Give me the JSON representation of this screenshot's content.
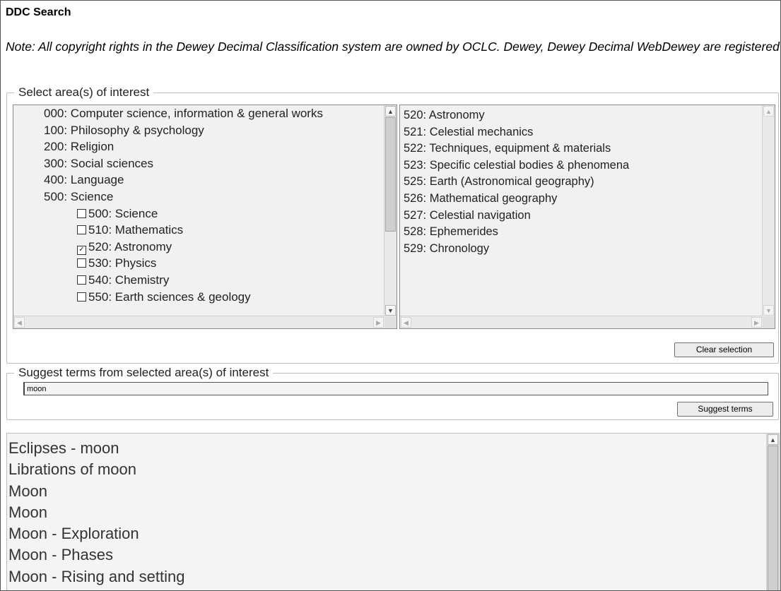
{
  "header": {
    "title": "DDC Search",
    "note": "Note: All copyright rights in the Dewey Decimal Classification system are owned by OCLC. Dewey, Dewey Decimal WebDewey are registered trademarks of OCLC."
  },
  "areas": {
    "legend": "Select area(s) of interest",
    "tree": [
      {
        "label": "000: Computer science, information & general works",
        "level": 0
      },
      {
        "label": "100: Philosophy & psychology",
        "level": 0
      },
      {
        "label": "200: Religion",
        "level": 0
      },
      {
        "label": "300: Social sciences",
        "level": 0
      },
      {
        "label": "400: Language",
        "level": 0
      },
      {
        "label": "500: Science",
        "level": 0
      },
      {
        "label": "500: Science",
        "level": 1,
        "checked": false
      },
      {
        "label": "510: Mathematics",
        "level": 1,
        "checked": false
      },
      {
        "label": "520: Astronomy",
        "level": 1,
        "checked": true
      },
      {
        "label": "530: Physics",
        "level": 1,
        "checked": false
      },
      {
        "label": "540: Chemistry",
        "level": 1,
        "checked": false
      },
      {
        "label": "550: Earth sciences & geology",
        "level": 1,
        "checked": false
      }
    ],
    "subclasses": [
      "520: Astronomy",
      "521: Celestial mechanics",
      "522: Techniques, equipment & materials",
      "523: Specific celestial bodies & phenomena",
      "525: Earth (Astronomical geography)",
      "526: Mathematical geography",
      "527: Celestial navigation",
      "528: Ephemerides",
      "529: Chronology"
    ],
    "clear_label": "Clear selection"
  },
  "suggest": {
    "legend": "Suggest terms from selected area(s) of interest",
    "value": "moon",
    "button_label": "Suggest terms"
  },
  "results": {
    "items": [
      "Eclipses - moon",
      "Librations of moon",
      "Moon",
      "Moon",
      "Moon - Exploration",
      "Moon - Phases",
      "Moon - Rising and setting"
    ]
  }
}
